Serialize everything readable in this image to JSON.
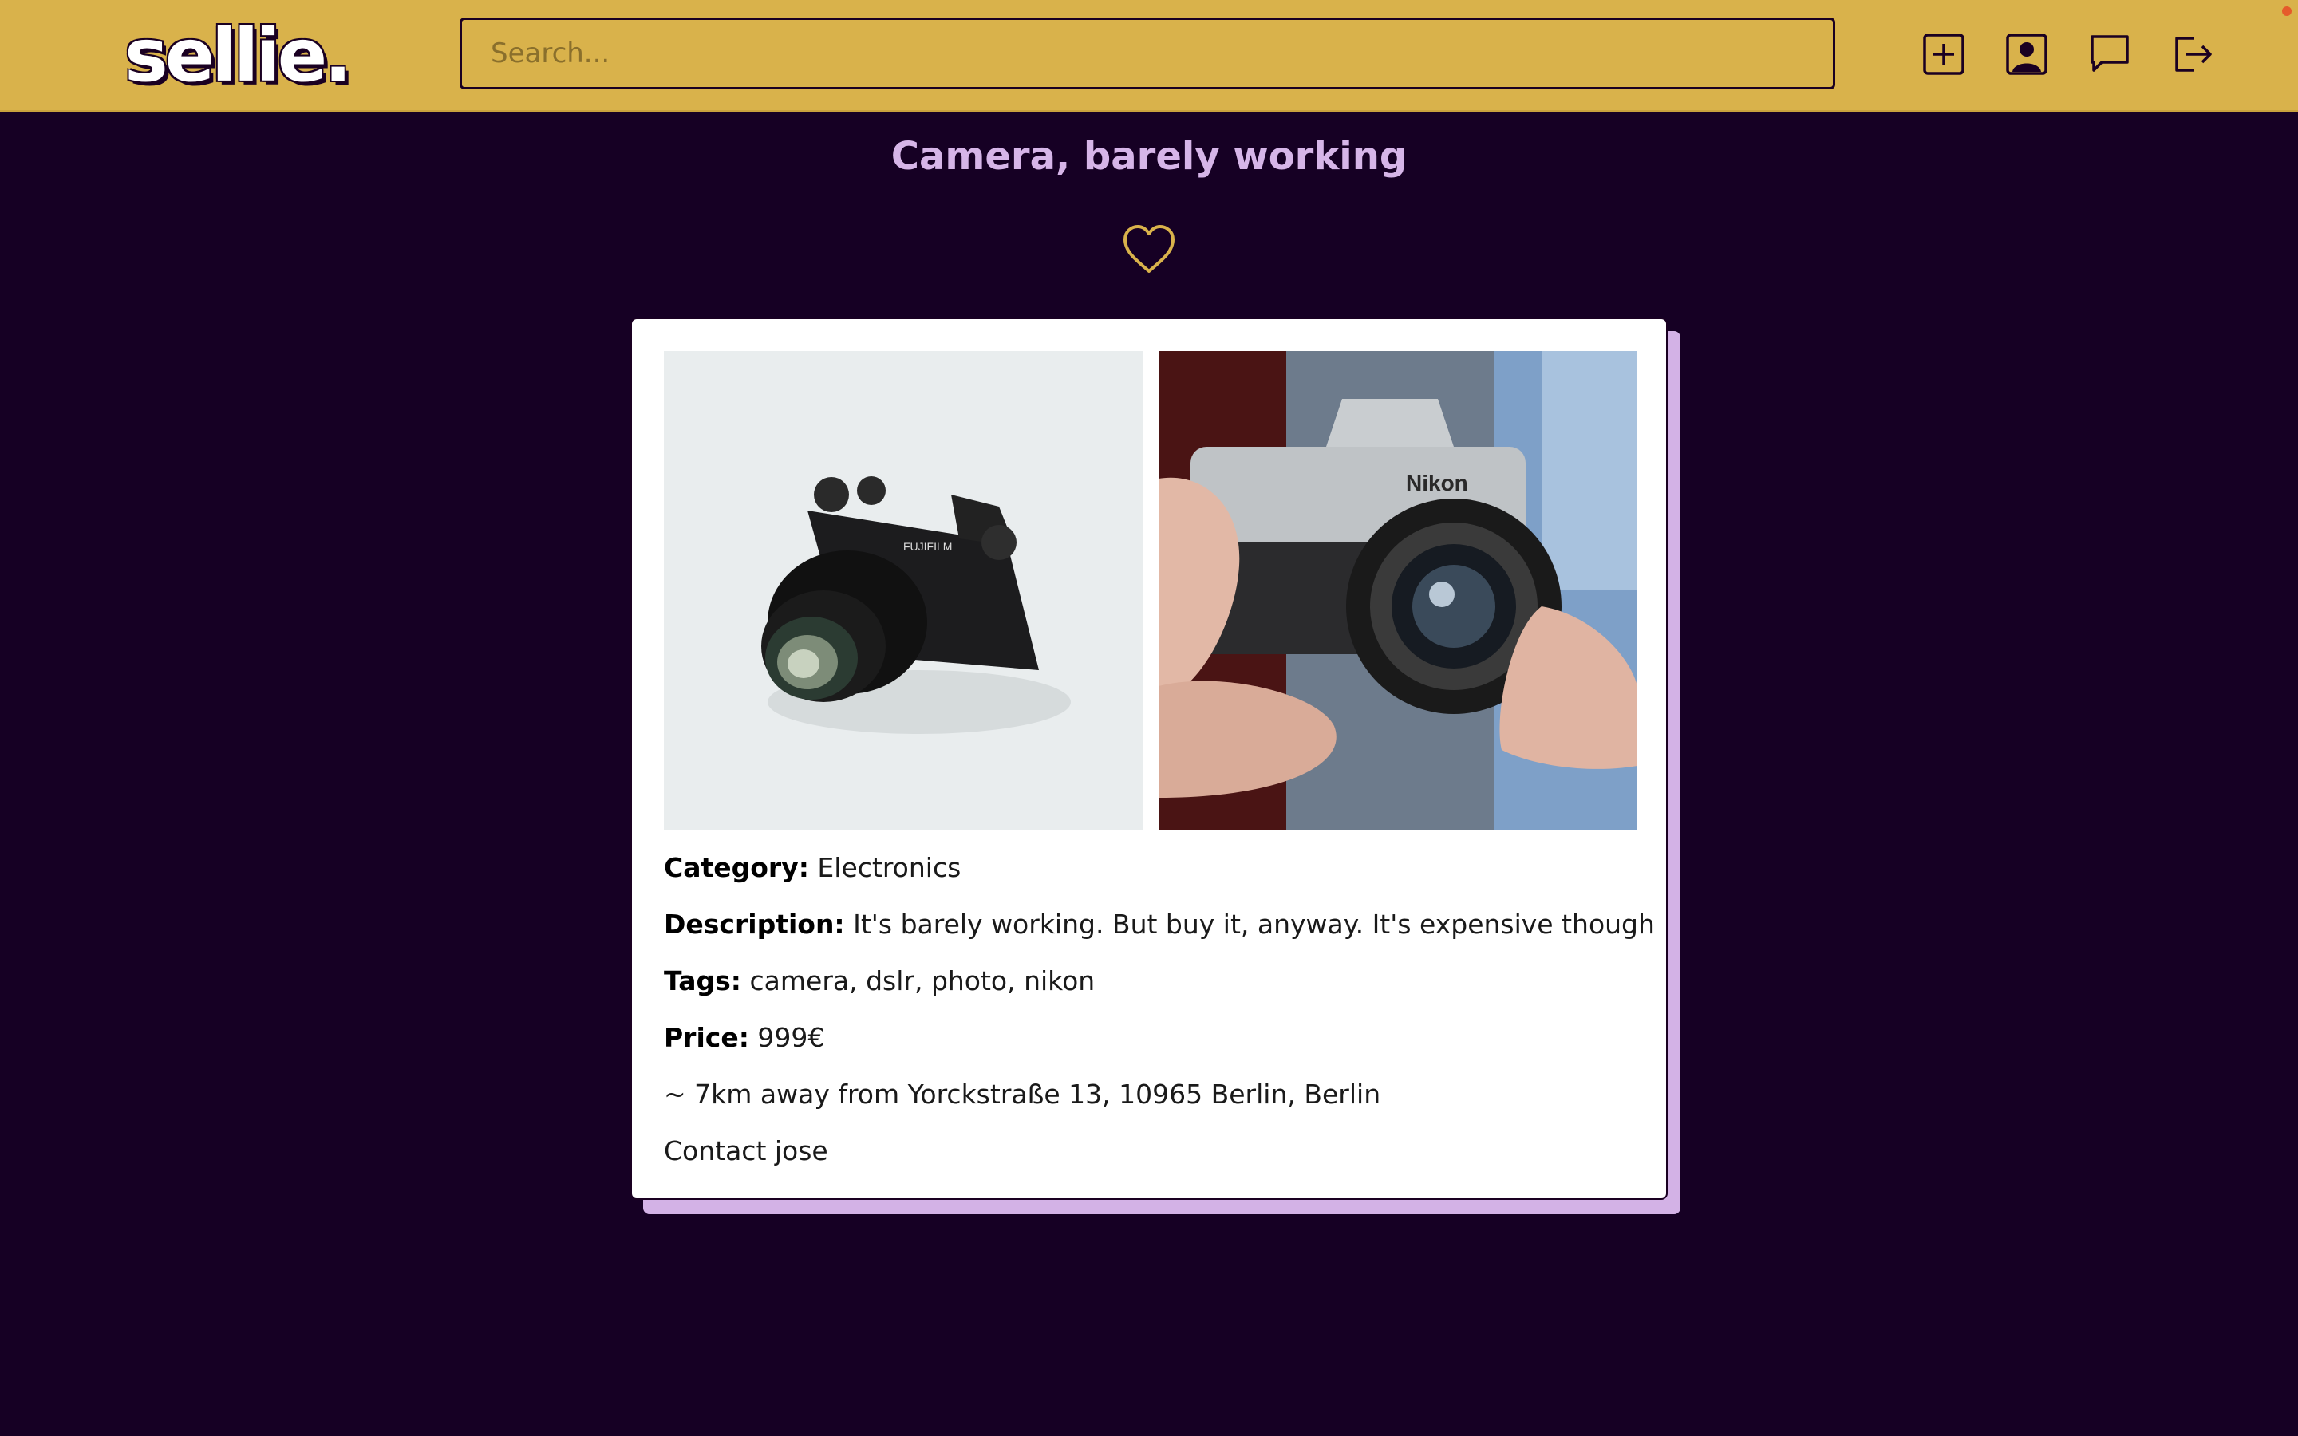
{
  "header": {
    "logo_text": "sellie.",
    "search_placeholder": "Search...",
    "icons": [
      "add-listing-icon",
      "profile-icon",
      "messages-icon",
      "logout-icon"
    ]
  },
  "listing": {
    "title": "Camera, barely working",
    "favorite_icon": "heart-outline-icon",
    "photos": [
      "black-mirrorless-camera-photo",
      "hands-holding-nikon-camera-photo"
    ],
    "category_label": "Category:",
    "category_value": "Electronics",
    "description_label": "Description:",
    "description_value": "It's barely working. But buy it, anyway. It's expensive though",
    "tags_label": "Tags:",
    "tags_value": "camera, dslr, photo, nikon",
    "price_label": "Price:",
    "price_value": "999€",
    "location_text": "~ 7km away from Yorckstraße 13, 10965 Berlin, Berlin",
    "contact_text": "Contact jose"
  },
  "colors": {
    "header_bg": "#d9b24b",
    "page_bg": "#160024",
    "title": "#d6b5e8",
    "card_shadow": "#d3b2e6",
    "heart": "#d9b24b"
  }
}
